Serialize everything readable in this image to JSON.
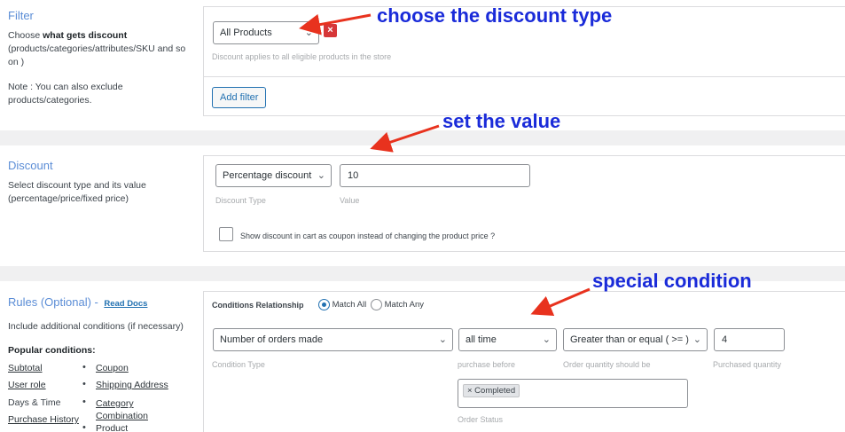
{
  "filter": {
    "title": "Filter",
    "desc_prefix": "Choose ",
    "desc_bold": "what gets discount",
    "desc_suffix": "(products/categories/attributes/SKU and so on )",
    "note": "Note : You can also exclude products/categories.",
    "select_value": "All Products",
    "remove_label": "×",
    "hint": "Discount applies to all eligible products in the store",
    "add_filter_label": "Add filter"
  },
  "discount": {
    "title": "Discount",
    "desc": "Select discount type and its value (percentage/price/fixed price)",
    "type_value": "Percentage discount",
    "type_caption": "Discount Type",
    "value": "10",
    "value_caption": "Value",
    "coupon_label": "Show discount in cart as coupon instead of changing the product price ?"
  },
  "rules": {
    "title": "Rules (Optional) -",
    "docs_link": "Read Docs",
    "desc": "Include additional conditions (if necessary)",
    "popular_heading": "Popular conditions:",
    "popular_left": [
      "Subtotal",
      "User role",
      "Days & Time",
      "Purchase History"
    ],
    "popular_left_linked": [
      true,
      true,
      false,
      true
    ],
    "popular_right": [
      "Coupon",
      "Shipping Address",
      "Category Combination",
      "Product"
    ],
    "relationship_label": "Conditions Relationship",
    "match_all": "Match All",
    "match_any": "Match Any",
    "condition_type": "Number of orders made",
    "condition_type_caption": "Condition Type",
    "purchase_before": "all time",
    "purchase_before_caption": "purchase before",
    "operator": "Greater than or equal ( >= )",
    "operator_caption": "Order quantity should be",
    "quantity": "4",
    "quantity_caption": "Purchased quantity",
    "status_tag": "× Completed",
    "status_caption": "Order Status"
  },
  "annotations": {
    "a1": "choose the discount type",
    "a2": "set the value",
    "a3": "special condition",
    "arrow_color": "#e8321e",
    "text_color": "#1a2bd9"
  }
}
